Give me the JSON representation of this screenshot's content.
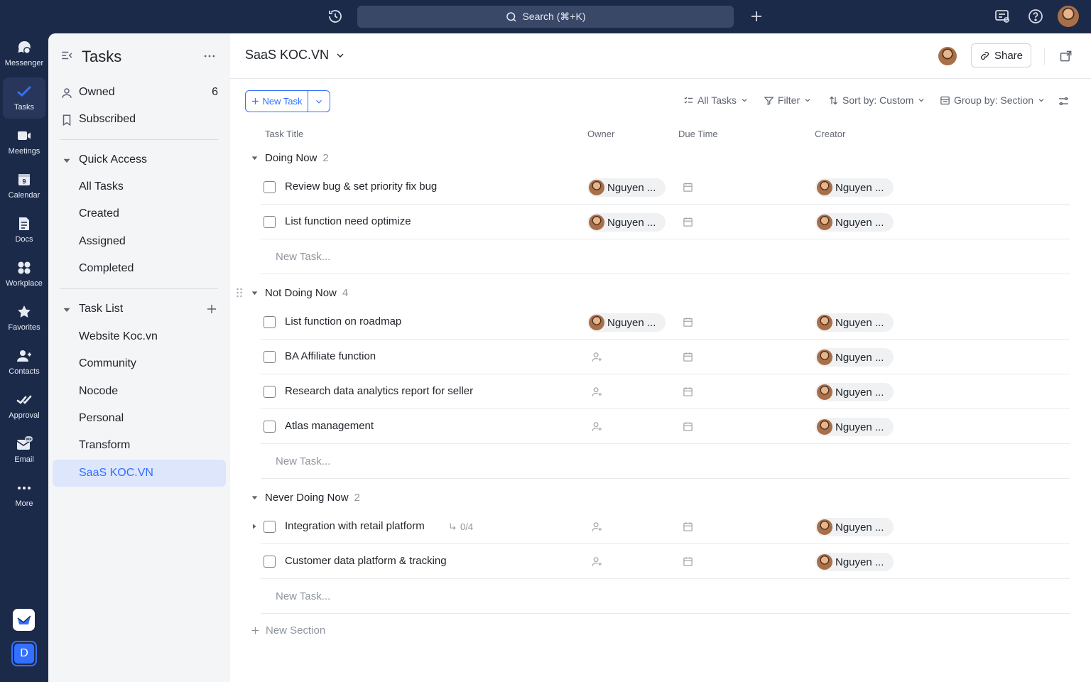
{
  "topbar": {
    "search_label": "Search (⌘+K)"
  },
  "rail": [
    {
      "label": "Messenger",
      "icon": "messenger-icon"
    },
    {
      "label": "Tasks",
      "icon": "tasks-icon",
      "active": true
    },
    {
      "label": "Meetings",
      "icon": "meetings-icon"
    },
    {
      "label": "Calendar",
      "icon": "calendar-icon",
      "badge": "9"
    },
    {
      "label": "Docs",
      "icon": "docs-icon"
    },
    {
      "label": "Workplace",
      "icon": "workplace-icon"
    },
    {
      "label": "Favorites",
      "icon": "star-icon"
    },
    {
      "label": "Contacts",
      "icon": "contacts-icon"
    },
    {
      "label": "Approval",
      "icon": "approval-icon"
    },
    {
      "label": "Email",
      "icon": "email-icon"
    },
    {
      "label": "More",
      "icon": "more-icon"
    }
  ],
  "workspace_initial": "D",
  "sidebar": {
    "title": "Tasks",
    "owned": {
      "label": "Owned",
      "count": "6"
    },
    "subscribed": "Subscribed",
    "quick_access": {
      "label": "Quick Access",
      "items": [
        "All Tasks",
        "Created",
        "Assigned",
        "Completed"
      ]
    },
    "task_list": {
      "label": "Task List",
      "items": [
        "Website Koc.vn",
        "Community",
        "Nocode",
        "Personal",
        "Transform",
        "SaaS KOC.VN"
      ],
      "selected": "SaaS KOC.VN"
    }
  },
  "header": {
    "title": "SaaS KOC.VN",
    "share_label": "Share"
  },
  "toolbar": {
    "new_task_label": "New Task",
    "all_tasks": "All Tasks",
    "filter": "Filter",
    "sort": "Sort by: Custom",
    "group": "Group by: Section"
  },
  "columns": {
    "title": "Task Title",
    "owner": "Owner",
    "due": "Due Time",
    "creator": "Creator"
  },
  "new_task_placeholder": "New Task...",
  "new_section_label": "New Section",
  "sections": [
    {
      "name": "Doing Now",
      "count": "2",
      "tasks": [
        {
          "title": "Review bug & set priority fix bug",
          "owner": "Nguyen ...",
          "creator": "Nguyen ..."
        },
        {
          "title": "List function need optimize",
          "owner": "Nguyen ...",
          "creator": "Nguyen ..."
        }
      ]
    },
    {
      "name": "Not Doing Now",
      "count": "4",
      "tasks": [
        {
          "title": "List function on roadmap",
          "owner": "Nguyen ...",
          "creator": "Nguyen ..."
        },
        {
          "title": "BA Affiliate function",
          "owner": "",
          "creator": "Nguyen ..."
        },
        {
          "title": "Research data analytics report for seller",
          "owner": "",
          "creator": "Nguyen ..."
        },
        {
          "title": "Atlas management",
          "owner": "",
          "creator": "Nguyen ..."
        }
      ]
    },
    {
      "name": "Never Doing Now",
      "count": "2",
      "tasks": [
        {
          "title": "Integration with retail platform",
          "owner": "",
          "creator": "Nguyen ...",
          "subtasks": "0/4"
        },
        {
          "title": "Customer data platform & tracking",
          "owner": "",
          "creator": "Nguyen ..."
        }
      ]
    }
  ]
}
